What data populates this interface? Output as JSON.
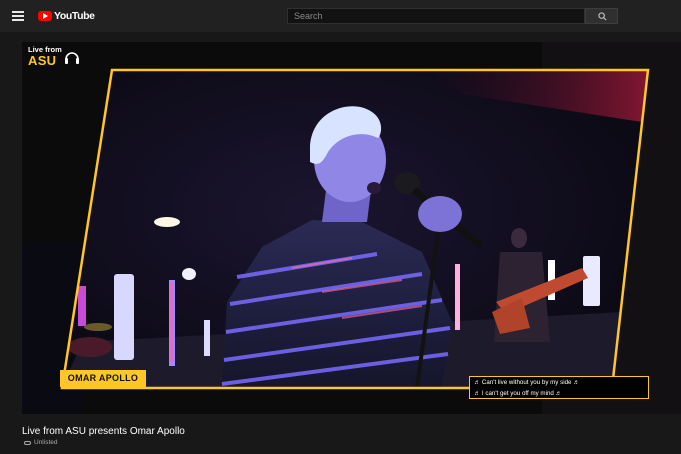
{
  "header": {
    "logo_text": "YouTube",
    "search_placeholder": "Search"
  },
  "video": {
    "brand_line1": "Live from",
    "brand_line2": "ASU",
    "lower_third_name": "OMAR APOLLO",
    "lyrics": [
      "♬ Can't live without you by my side ♬",
      "♬ I can't get you off my mind ♬"
    ],
    "frame_color": "#ffc627"
  },
  "details": {
    "title": "Live from ASU presents Omar Apollo",
    "visibility": "Unlisted"
  }
}
